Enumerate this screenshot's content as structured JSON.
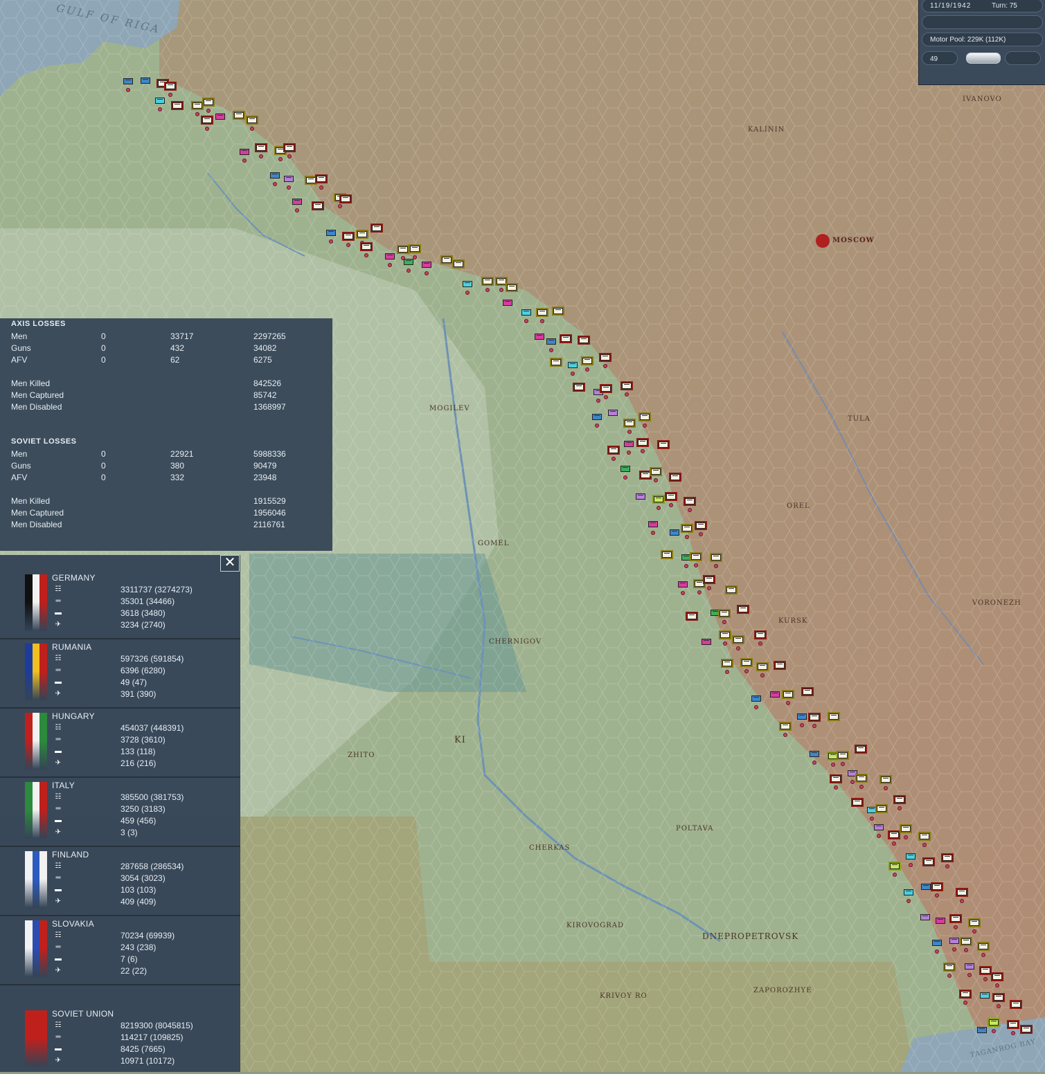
{
  "map": {
    "labels": {
      "gulf": "GULF OF RIGA",
      "moscow": "MOSCOW",
      "tula": "TULA",
      "orel": "OREL",
      "kursk": "KURSK",
      "voronezh": "VORONEZH",
      "gomel": "GOMEL",
      "mogilev": "MOGILEV",
      "chernigov": "CHERNIGOV",
      "kiev": "KI",
      "poltava": "POLTAVA",
      "cherkasy": "CHERKAS",
      "kirovograd": "KIROVOGRAD",
      "dnepropetrovsk": "DNEPROPETROVSK",
      "zaporozhye": "ZAPOROZHYE",
      "krivoy": "KRIVOY RO",
      "taganrog": "TAGANROG BAY",
      "kalinin": "KALININ",
      "ivanovo": "IVANOVO",
      "zhitomir": "ZHITO"
    }
  },
  "hud": {
    "date": "11/19/1942",
    "turn": "Turn: 75",
    "motor_pool": "Motor Pool:  229K (112K)",
    "value": "49"
  },
  "axis_losses": {
    "header": "AXIS LOSSES",
    "rows": [
      {
        "label": "Men",
        "a": "0",
        "b": "33717",
        "c": "2297265"
      },
      {
        "label": "Guns",
        "a": "0",
        "b": "432",
        "c": "34082"
      },
      {
        "label": "AFV",
        "a": "0",
        "b": "62",
        "c": "6275"
      }
    ],
    "summary": [
      {
        "label": "Men Killed",
        "value": "842526"
      },
      {
        "label": "Men Captured",
        "value": "85742"
      },
      {
        "label": "Men Disabled",
        "value": "1368997"
      }
    ]
  },
  "soviet_losses": {
    "header": "SOVIET LOSSES",
    "rows": [
      {
        "label": "Men",
        "a": "0",
        "b": "22921",
        "c": "5988336"
      },
      {
        "label": "Guns",
        "a": "0",
        "b": "380",
        "c": "90479"
      },
      {
        "label": "AFV",
        "a": "0",
        "b": "332",
        "c": "23948"
      }
    ],
    "summary": [
      {
        "label": "Men Killed",
        "value": "1915529"
      },
      {
        "label": "Men Captured",
        "value": "1956046"
      },
      {
        "label": "Men Disabled",
        "value": "2116761"
      }
    ]
  },
  "nations_panel": {
    "close": "✕",
    "stat_icons": [
      "men-icon",
      "guns-icon",
      "afv-icon",
      "aircraft-icon"
    ],
    "nations": [
      {
        "name": "GERMANY",
        "flag_colors": [
          "#101010",
          "#f2f2f2",
          "#c0201c"
        ],
        "stats": [
          "3311737 (3274273)",
          "35301 (34466)",
          "3618 (3480)",
          "3234 (2740)"
        ]
      },
      {
        "name": "RUMANIA",
        "flag_colors": [
          "#1c3c9c",
          "#f0c020",
          "#c0201c"
        ],
        "stats": [
          "597326 (591854)",
          "6396 (6280)",
          "49 (47)",
          "391 (390)"
        ]
      },
      {
        "name": "HUNGARY",
        "flag_colors": [
          "#c0201c",
          "#f2f2f2",
          "#2c8a3c"
        ],
        "stats": [
          "454037 (448391)",
          "3728 (3610)",
          "133 (118)",
          "216 (216)"
        ]
      },
      {
        "name": "ITALY",
        "flag_colors": [
          "#2c8a3c",
          "#f2f2f2",
          "#c0201c"
        ],
        "stats": [
          "385500 (381753)",
          "3250 (3183)",
          "459 (456)",
          "3 (3)"
        ]
      },
      {
        "name": "FINLAND",
        "flag_colors": [
          "#f2f2f2",
          "#2c5cc0",
          "#f2f2f2"
        ],
        "stats": [
          "287658 (286534)",
          "3054 (3023)",
          "103 (103)",
          "409 (409)"
        ]
      },
      {
        "name": "SLOVAKIA",
        "flag_colors": [
          "#f2f2f2",
          "#2c4cb0",
          "#c0201c"
        ],
        "stats": [
          "70234 (69939)",
          "243 (238)",
          "7 (6)",
          "22 (22)"
        ]
      },
      {
        "name": "SOVIET UNION",
        "flag_colors": [
          "#c0201c",
          "#c0201c",
          "#c0201c"
        ],
        "stats": [
          "8219300 (8045815)",
          "114217 (109825)",
          "8425 (7665)",
          "10971 (10172)"
        ]
      }
    ]
  }
}
